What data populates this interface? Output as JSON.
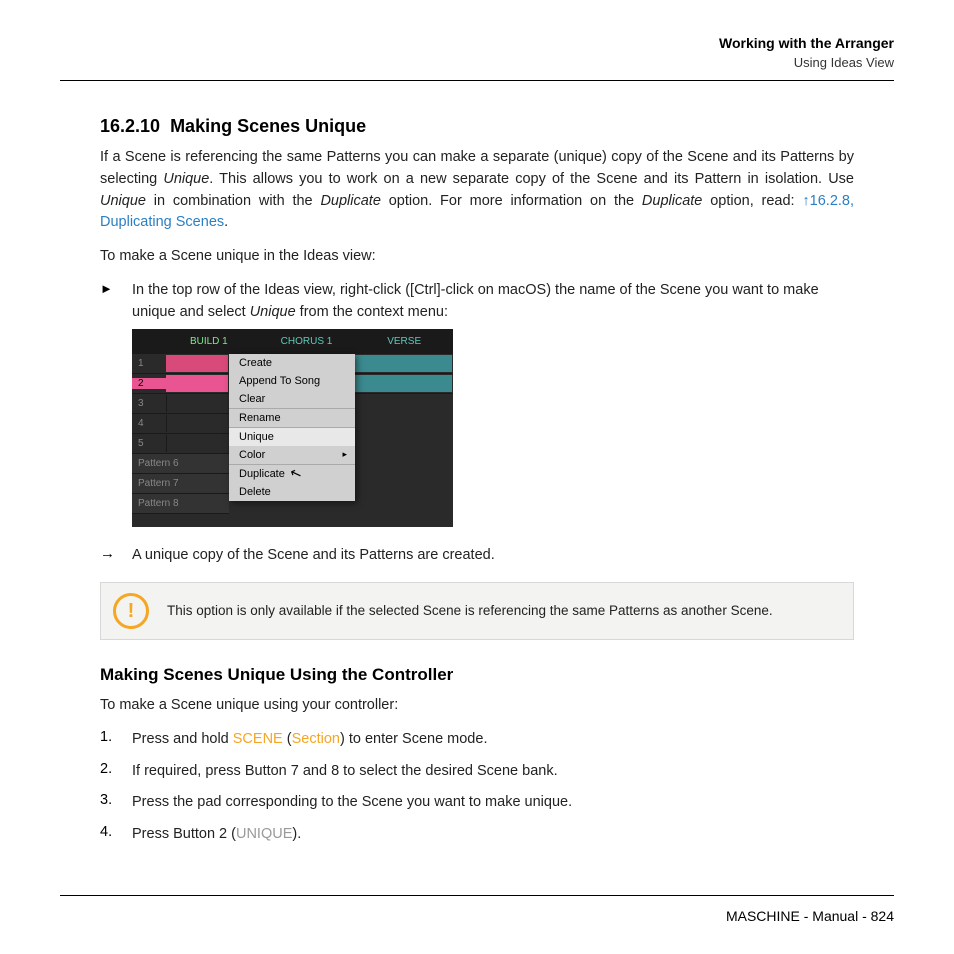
{
  "header": {
    "chapter": "Working with the Arranger",
    "section": "Using Ideas View"
  },
  "h3_num": "16.2.10",
  "h3_title": "Making Scenes Unique",
  "p1_a": "If a Scene is referencing the same Patterns you can make a separate (unique) copy of the Scene and its Patterns by selecting ",
  "p1_b": "Unique",
  "p1_c": ". This allows you to work on a new separate copy of the Scene and its Pattern in isolation. Use ",
  "p1_d": "Unique",
  "p1_e": " in combination with the ",
  "p1_f": "Duplicate",
  "p1_g": " option. For more information on the ",
  "p1_h": "Duplicate",
  "p1_i": " option, read: ",
  "p1_link": "↑16.2.8, Duplicating Scenes",
  "p1_j": ".",
  "p2": "To make a Scene unique in the Ideas view:",
  "step1_a": "In the top row of the Ideas view, right-click ([Ctrl]-click on macOS) the name of the Scene you want to make unique and select ",
  "step1_b": "Unique",
  "step1_c": " from the context menu:",
  "result1": "A unique copy of the Scene and its Patterns are created.",
  "info": "This option is only available if the selected Scene is referencing the same Patterns as another Scene.",
  "h4": "Making Scenes Unique Using the Controller",
  "p3": "To make a Scene unique using your controller:",
  "ol": {
    "1_a": "Press and hold ",
    "1_b": "SCENE",
    "1_c": " (",
    "1_d": "Section",
    "1_e": ") to enter Scene mode.",
    "2": "If required, press Button 7 and 8 to select the desired Scene bank.",
    "3": "Press the pad corresponding to the Scene you want to make unique.",
    "4_a": "Press Button 2 (",
    "4_b": "UNIQUE",
    "4_c": ")."
  },
  "footer": "MASCHINE - Manual - 824",
  "figure": {
    "tabs": {
      "build": "BUILD 1",
      "chorus": "CHORUS 1",
      "verse": "VERSE"
    },
    "rows": [
      "1",
      "2",
      "3",
      "4",
      "5"
    ],
    "patterns": [
      "Pattern 6",
      "Pattern 7",
      "Pattern 8"
    ],
    "right_labels": {
      "r1": "1",
      "r2": "2"
    },
    "menu": [
      "Create",
      "Append To Song",
      "Clear",
      "Rename",
      "Unique",
      "Color",
      "Duplicate",
      "Delete"
    ]
  }
}
